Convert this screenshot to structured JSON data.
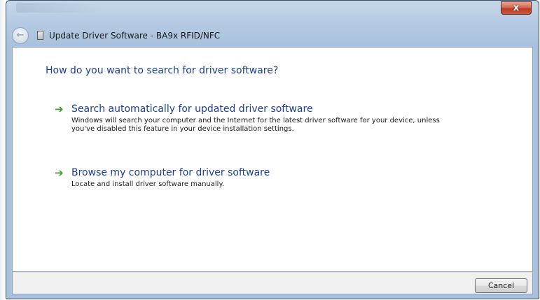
{
  "window": {
    "close_label": "x"
  },
  "titlebar": {
    "back_glyph": "←",
    "title": "Update Driver Software - BA9x RFID/NFC"
  },
  "main": {
    "heading": "How do you want to search for driver software?",
    "options": [
      {
        "icon": "green-arrow-icon",
        "arrow_glyph": "➔",
        "title": "Search automatically for updated driver software",
        "description": "Windows will search your computer and the Internet for the latest driver software for your device, unless you've disabled this feature in your device installation settings."
      },
      {
        "icon": "green-arrow-icon",
        "arrow_glyph": "➔",
        "title": "Browse my computer for driver software",
        "description": "Locate and install driver software manually."
      }
    ]
  },
  "footer": {
    "cancel_label": "Cancel"
  },
  "colors": {
    "link_blue": "#1c3f94",
    "arrow_green": "#3d9b2c",
    "frame_blue": "#a9c1dc",
    "close_red": "#c9593f"
  }
}
